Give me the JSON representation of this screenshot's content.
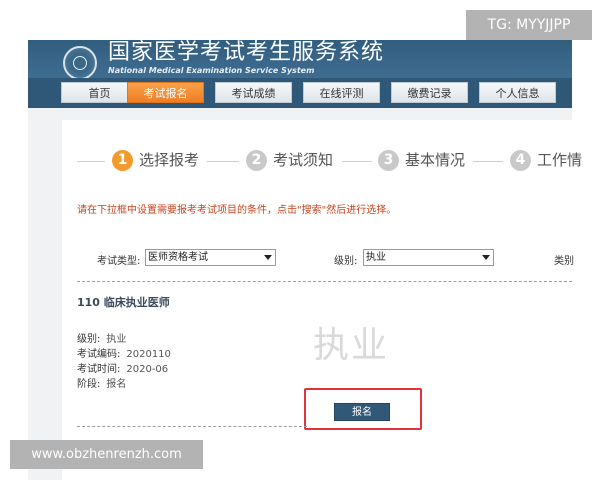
{
  "header": {
    "title": "国家医学考试考生服务系统",
    "subtitle": "National Medical Examination Service System"
  },
  "nav": {
    "items": [
      {
        "label": "首页",
        "active": false
      },
      {
        "label": "考试报名",
        "active": true
      },
      {
        "label": "考试成绩",
        "active": false
      },
      {
        "label": "在线评测",
        "active": false
      },
      {
        "label": "缴费记录",
        "active": false
      },
      {
        "label": "个人信息",
        "active": false
      }
    ]
  },
  "steps": [
    {
      "number": "1",
      "label": "选择报考",
      "active": true
    },
    {
      "number": "2",
      "label": "考试须知",
      "active": false
    },
    {
      "number": "3",
      "label": "基本情况",
      "active": false
    },
    {
      "number": "4",
      "label": "工作情",
      "active": false
    }
  ],
  "notice": "请在下拉框中设置需要报考考试项目的条件，点击\"搜索\"然后进行选择。",
  "filters": {
    "exam_type_label": "考试类型:",
    "exam_type_value": "医师资格考试",
    "level_label": "级别:",
    "level_value": "执业",
    "category_label": "类别"
  },
  "exam": {
    "title": "110 临床执业医师",
    "level_label": "级别:",
    "level_value": "执业",
    "code_label": "考试编码:",
    "code_value": "2020110",
    "time_label": "考试时间:",
    "time_value": "2020-06",
    "stage_label": "阶段:",
    "stage_value": "报名",
    "watermark": "执业",
    "apply_button": "报名"
  },
  "overlays": {
    "tg": "TG: MYYJJPP",
    "url": "www.obzhenrenzh.com"
  },
  "colors": {
    "header_blue": "#3f6d91",
    "nav_active_orange": "#ef7e23",
    "step_active": "#f29a2e",
    "notice_red": "#c9431d",
    "highlight_red": "#e0333a",
    "apply_button_blue": "#315877"
  }
}
